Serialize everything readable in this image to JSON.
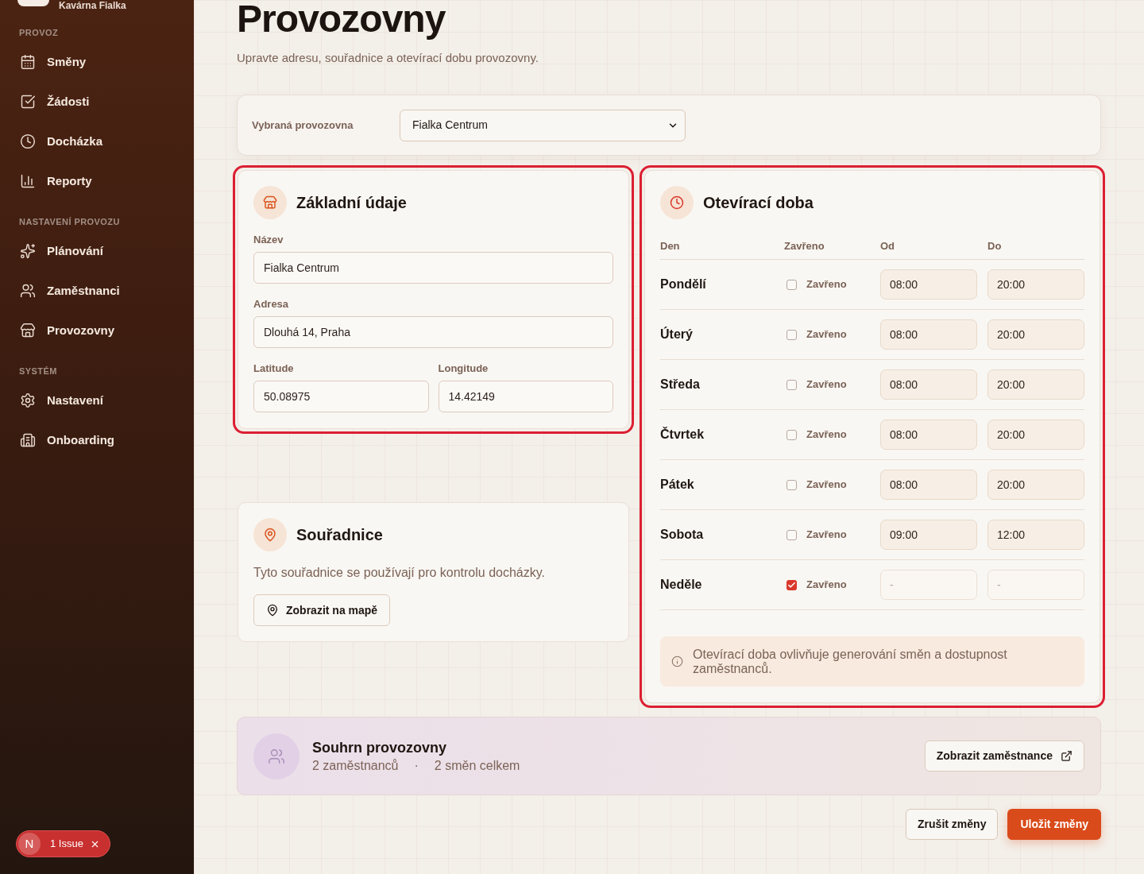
{
  "sidebar": {
    "brand": {
      "name": "Kavárna Fialka"
    },
    "sections": [
      {
        "title": "PROVOZ",
        "items": [
          {
            "label": "Směny"
          },
          {
            "label": "Žádosti"
          },
          {
            "label": "Docházka"
          },
          {
            "label": "Reporty"
          }
        ]
      },
      {
        "title": "NASTAVENÍ PROVOZU",
        "items": [
          {
            "label": "Plánování"
          },
          {
            "label": "Zaměstnanci"
          },
          {
            "label": "Provozovny"
          }
        ]
      },
      {
        "title": "SYSTÉM",
        "items": [
          {
            "label": "Nastavení"
          },
          {
            "label": "Onboarding"
          }
        ]
      }
    ]
  },
  "dev_badge": {
    "logo_letter": "N",
    "label": "1 Issue"
  },
  "page": {
    "title": "Provozovny",
    "subtitle": "Upravte adresu, souřadnice a otevírací dobu provozovny."
  },
  "selector": {
    "label": "Vybraná provozovna",
    "value": "Fialka Centrum"
  },
  "basic_info": {
    "title": "Základní údaje",
    "highlighted": true,
    "fields": [
      {
        "label": "Název",
        "value": "Fialka Centrum"
      },
      {
        "label": "Adresa",
        "value": "Dlouhá 14, Praha"
      },
      {
        "label": "Latitude",
        "value": "50.08975"
      },
      {
        "label": "Longitude",
        "value": "14.42149"
      }
    ]
  },
  "coordinates": {
    "title": "Souřadnice",
    "highlighted": false,
    "description": "Tyto souřadnice se používají pro kontrolu docházky.",
    "button": "Zobrazit na mapě"
  },
  "opening_hours": {
    "title": "Otevírací doba",
    "highlighted": true,
    "columns": [
      "Den",
      "Zavřeno",
      "Od",
      "Do"
    ],
    "days": [
      {
        "name": "Pondělí",
        "closed": false,
        "closed_label": "Zavřeno",
        "from": "08:00",
        "to": "20:00"
      },
      {
        "name": "Úterý",
        "closed": false,
        "closed_label": "Zavřeno",
        "from": "08:00",
        "to": "20:00"
      },
      {
        "name": "Středa",
        "closed": false,
        "closed_label": "Zavřeno",
        "from": "08:00",
        "to": "20:00"
      },
      {
        "name": "Čtvrtek",
        "closed": false,
        "closed_label": "Zavřeno",
        "from": "08:00",
        "to": "20:00"
      },
      {
        "name": "Pátek",
        "closed": false,
        "closed_label": "Zavřeno",
        "from": "08:00",
        "to": "20:00"
      },
      {
        "name": "Sobota",
        "closed": false,
        "closed_label": "Zavřeno",
        "from": "09:00",
        "to": "12:00"
      },
      {
        "name": "Neděle",
        "closed": true,
        "closed_label": "Zavřeno",
        "from": "-",
        "to": "-"
      }
    ],
    "note": "Otevírací doba ovlivňuje generování směn a dostupnost zaměstnanců."
  },
  "summary": {
    "title": "Souhrn provozovny",
    "stats": [
      "2 zaměstnanců",
      "2 směn celkem"
    ],
    "separator": "·",
    "button": "Zobrazit zaměstnance"
  },
  "actions": [
    {
      "label": "Zrušit změny",
      "kind": "secondary"
    },
    {
      "label": "Uložit změny",
      "kind": "primary"
    }
  ]
}
